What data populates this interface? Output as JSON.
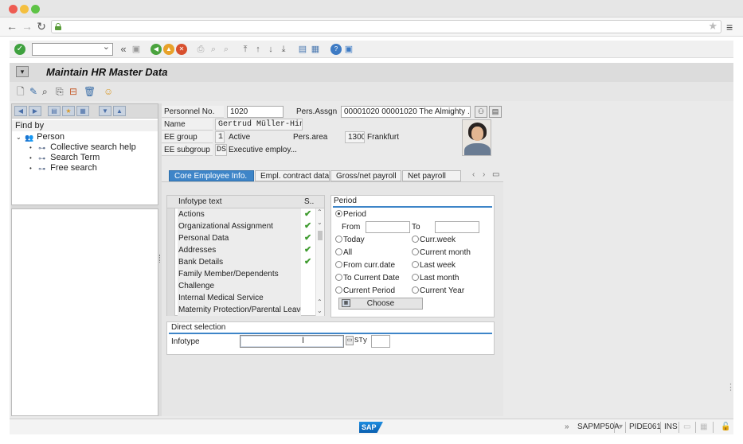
{
  "toolbar": {
    "command_field_value": "",
    "back_glyph": "«"
  },
  "title": "Maintain HR Master Data",
  "left_panel": {
    "find_by": "Find by",
    "tree": {
      "root": "Person",
      "children": [
        "Collective search help",
        "Search Term",
        "Free search"
      ]
    }
  },
  "header": {
    "personnel_no_label": "Personnel No.",
    "personnel_no": "1020",
    "pers_assgn_label": "Pers.Assgn",
    "pers_assgn_value": "00001020 00001020 The Almighty ...",
    "name_label": "Name",
    "name_value": "Gertrud Müller-Hinze",
    "ee_group_label": "EE group",
    "ee_group_code": "1",
    "ee_group_text": "Active",
    "pers_area_label": "Pers.area",
    "pers_area_code": "1300",
    "pers_area_text": "Frankfurt",
    "ee_subgroup_label": "EE subgroup",
    "ee_subgroup_code": "DS",
    "ee_subgroup_text": "Executive employ..."
  },
  "tabs": [
    {
      "label": "Core Employee Info.",
      "active": true
    },
    {
      "label": "Empl. contract data",
      "active": false
    },
    {
      "label": "Gross/net payroll",
      "active": false
    },
    {
      "label": "Net payroll",
      "active": false
    }
  ],
  "infotype_table": {
    "col_text": "Infotype text",
    "col_s": "S..",
    "rows": [
      {
        "text": "Actions",
        "check": "✔"
      },
      {
        "text": "Organizational Assignment",
        "check": "✔"
      },
      {
        "text": "Personal Data",
        "check": "✔"
      },
      {
        "text": "Addresses",
        "check": "✔"
      },
      {
        "text": "Bank Details",
        "check": "✔"
      },
      {
        "text": "Family Member/Dependents",
        "check": ""
      },
      {
        "text": "Challenge",
        "check": ""
      },
      {
        "text": "Internal Medical Service",
        "check": ""
      },
      {
        "text": "Maternity Protection/Parental Leave",
        "check": ""
      }
    ]
  },
  "period": {
    "title": "Period",
    "period_option": "Period",
    "from_label": "From",
    "to_label": "To",
    "from_value": "",
    "to_value": "",
    "left_options": [
      "Today",
      "All",
      "From curr.date",
      "To Current Date",
      "Current Period"
    ],
    "right_options": [
      "Curr.week",
      "Current month",
      "Last week",
      "Last month",
      "Current Year"
    ],
    "choose_label": "Choose"
  },
  "direct_selection": {
    "title": "Direct selection",
    "infotype_label": "Infotype",
    "infotype_value": "",
    "sty_label": "STy",
    "sty_value": ""
  },
  "status_bar": {
    "logo": "SAP",
    "program": "SAPMP50A",
    "system": "PIDE061",
    "mode": "INS"
  },
  "colors": {
    "accent": "#3e85c8",
    "check": "#3e9b2e"
  }
}
